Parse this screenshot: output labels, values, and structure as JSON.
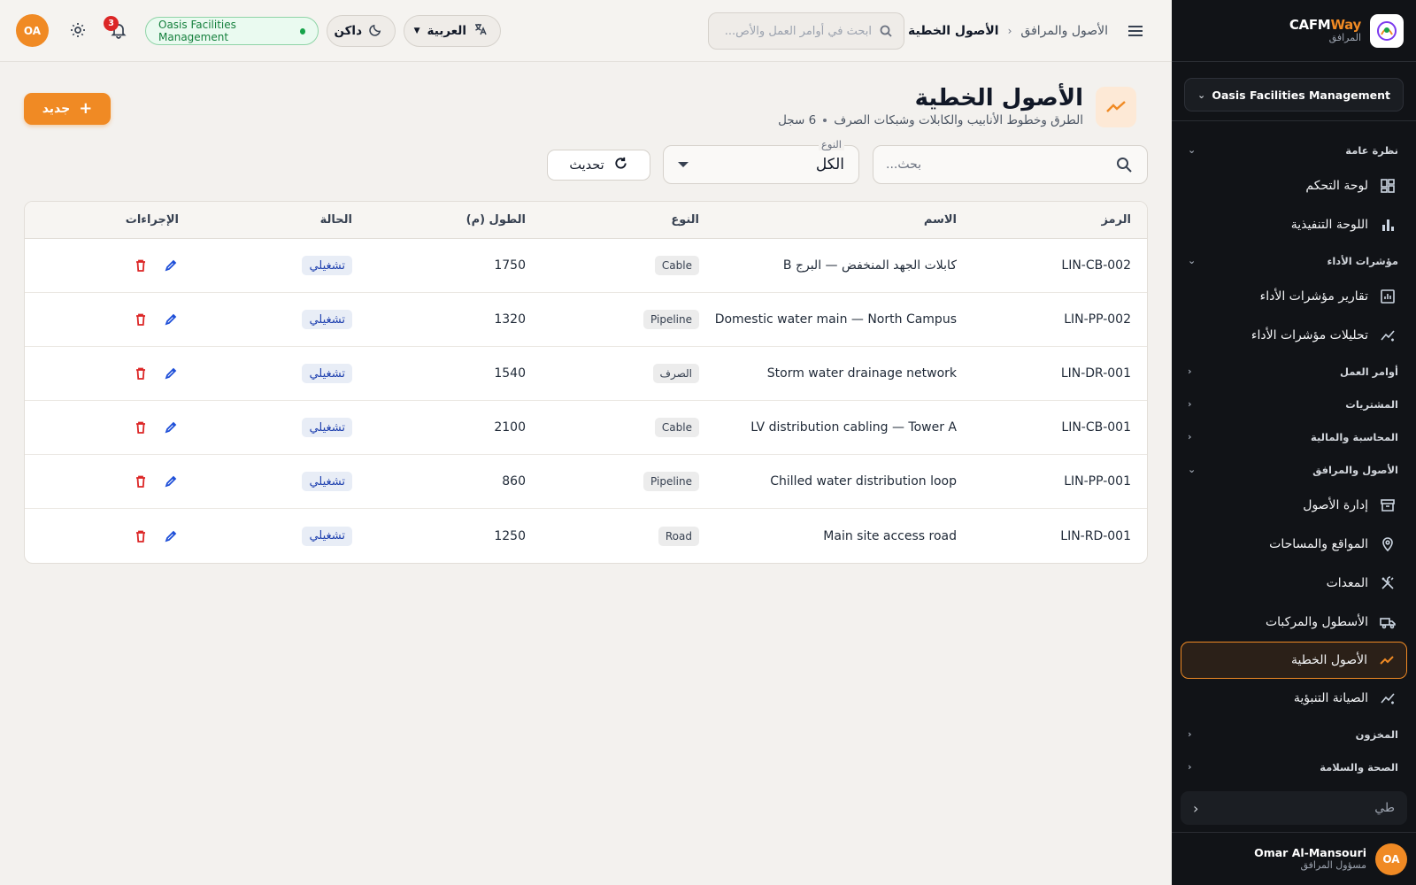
{
  "sidebar": {
    "brand": {
      "name_main": "CAFM",
      "name_accent": "Way",
      "subtitle": "المرافق"
    },
    "org_selector": "Oasis Facilities Management",
    "sections": {
      "overview": "نظرة عامة",
      "kpi": "مؤشرات الأداء",
      "work_orders": "أوامر العمل",
      "procurement": "المشتريات",
      "accounting": "المحاسبة والمالية",
      "assets": "الأصول والمرافق",
      "inventory": "المخزون",
      "hse": "الصحة والسلامة"
    },
    "items": {
      "dashboard": "لوحة التحكم",
      "executive": "اللوحة التنفيذية",
      "kpi_reports": "تقارير مؤشرات الأداء",
      "kpi_analytics": "تحليلات مؤشرات الأداء",
      "asset_mgmt": "إدارة الأصول",
      "locations": "المواقع والمساحات",
      "equipment": "المعدات",
      "fleet": "الأسطول والمركبات",
      "linear_assets": "الأصول الخطية",
      "predictive": "الصيانة التنبؤية"
    },
    "collapse_label": "طي",
    "user": {
      "initials": "OA",
      "name": "Omar Al-Mansouri",
      "role": "مسؤول المرافق"
    }
  },
  "topbar": {
    "breadcrumb": {
      "parent": "الأصول والمرافق",
      "current": "الأصول الخطية"
    },
    "search_placeholder": "ابحث في أوامر العمل والأص...",
    "language": "العربية",
    "theme": "داكن",
    "org_badge": "Oasis Facilities Management",
    "notifications_count": "3",
    "user_initials": "OA"
  },
  "page": {
    "title": "الأصول الخطية",
    "subtitle": "الطرق وخطوط الأنابيب والكابلات وشبكات الصرف",
    "record_count": "6 سجل",
    "new_button": "جديد",
    "search_placeholder": "بحث...",
    "type_filter_label": "النوع",
    "type_filter_value": "الكل",
    "refresh_button": "تحديث"
  },
  "table": {
    "headers": {
      "code": "الرمز",
      "name": "الاسم",
      "type": "النوع",
      "length": "الطول (م)",
      "status": "الحالة",
      "actions": "الإجراءات"
    },
    "rows": [
      {
        "code": "LIN-CB-002",
        "name": "كابلات الجهد المنخفض — البرج B",
        "type": "Cable",
        "length": "1750",
        "status": "تشغيلي"
      },
      {
        "code": "LIN-PP-002",
        "name": "Domestic water main — North Campus",
        "type": "Pipeline",
        "length": "1320",
        "status": "تشغيلي"
      },
      {
        "code": "LIN-DR-001",
        "name": "Storm water drainage network",
        "type": "الصرف",
        "length": "1540",
        "status": "تشغيلي"
      },
      {
        "code": "LIN-CB-001",
        "name": "LV distribution cabling — Tower A",
        "type": "Cable",
        "length": "2100",
        "status": "تشغيلي"
      },
      {
        "code": "LIN-PP-001",
        "name": "Chilled water distribution loop",
        "type": "Pipeline",
        "length": "860",
        "status": "تشغيلي"
      },
      {
        "code": "LIN-RD-001",
        "name": "Main site access road",
        "type": "Road",
        "length": "1250",
        "status": "تشغيلي"
      }
    ]
  },
  "colors": {
    "accent": "#f08a24",
    "sidebar_bg": "#111317",
    "status_text": "#1e40af",
    "delete": "#dc2626",
    "edit": "#1d4ed8"
  }
}
